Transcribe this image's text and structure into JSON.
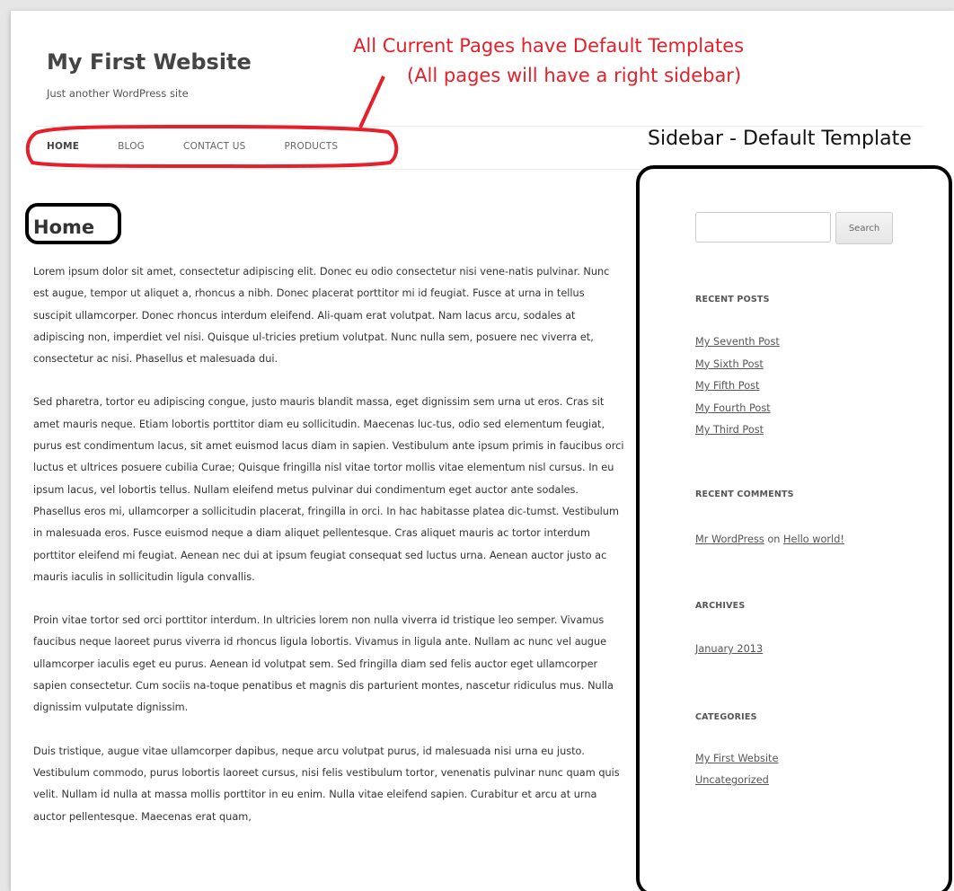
{
  "site": {
    "title": "My First Website",
    "description": "Just another WordPress site"
  },
  "nav": {
    "items": [
      "HOME",
      "BLOG",
      "CONTACT US",
      "PRODUCTS"
    ]
  },
  "annotations": {
    "red_line1": "All Current Pages have Default Templates",
    "red_line2": "(All pages will have a right sidebar)",
    "sidebar_label": "Sidebar - Default Template",
    "red_color": "#e5202b",
    "black_color": "#000000"
  },
  "page": {
    "title": "Home",
    "paragraphs": [
      "Lorem ipsum dolor sit amet, consectetur adipiscing elit. Donec eu odio consectetur nisi vene-natis pulvinar. Nunc est augue, tempor ut aliquet a, rhoncus a nibh. Donec placerat porttitor mi id feugiat. Fusce at urna in tellus suscipit ullamcorper. Donec rhoncus interdum eleifend. Ali-quam erat volutpat. Nam lacus arcu, sodales at adipiscing non, imperdiet vel nisi. Quisque ul-tricies pretium volutpat. Nunc nulla sem, posuere nec viverra et, consectetur ac nisi. Phasellus et malesuada dui.",
      "Sed pharetra, tortor eu adipiscing congue, justo mauris blandit massa, eget dignissim sem urna ut eros. Cras sit amet mauris neque. Etiam lobortis porttitor diam eu sollicitudin. Maecenas luc-tus, odio sed elementum feugiat, purus est condimentum lacus, sit amet euismod lacus diam in sapien. Vestibulum ante ipsum primis in faucibus orci luctus et ultrices posuere cubilia Curae; Quisque fringilla nisl vitae tortor mollis vitae elementum nisl cursus. In eu ipsum lacus, vel lobortis tellus. Nullam eleifend metus pulvinar dui condimentum eget auctor ante sodales. Phasellus eros mi, ullamcorper a sollicitudin placerat, fringilla in orci. In hac habitasse platea dic-tumst. Vestibulum in malesuada eros. Fusce euismod neque a diam aliquet pellentesque. Cras aliquet mauris ac tortor interdum porttitor eleifend mi feugiat. Aenean nec dui at ipsum feugiat consequat sed luctus urna. Aenean auctor justo ac mauris iaculis in sollicitudin ligula convallis.",
      "Proin vitae tortor sed orci porttitor interdum. In ultricies lorem non nulla viverra id tristique leo semper. Vivamus faucibus neque laoreet purus viverra id rhoncus ligula lobortis. Vivamus in ligula ante. Nullam ac nunc vel augue ullamcorper iaculis eget eu purus. Aenean id volutpat sem. Sed fringilla diam sed felis auctor eget ullamcorper sapien consectetur. Cum sociis na-toque penatibus et magnis dis parturient montes, nascetur ridiculus mus. Nulla dignissim vulputate dignissim.",
      "Duis tristique, augue vitae ullamcorper dapibus, neque arcu volutpat purus, id malesuada nisi urna eu justo. Vestibulum commodo, purus lobortis laoreet cursus, nisi felis vestibulum tortor, venenatis pulvinar nunc quam quis velit. Nullam id nulla at massa mollis porttitor in eu enim. Nulla vitae eleifend sapien. Curabitur et arcu at urna auctor pellentesque. Maecenas erat quam,"
    ]
  },
  "sidebar": {
    "search_button": "Search",
    "search_placeholder": "",
    "recent_posts": {
      "title": "RECENT POSTS",
      "items": [
        "My Seventh Post",
        "My Sixth Post",
        "My Fifth Post",
        "My Fourth Post",
        "My Third Post"
      ]
    },
    "recent_comments": {
      "title": "RECENT COMMENTS",
      "author": "Mr WordPress",
      "connector": "on",
      "post": "Hello world!"
    },
    "archives": {
      "title": "ARCHIVES",
      "items": [
        "January 2013"
      ]
    },
    "categories": {
      "title": "CATEGORIES",
      "items": [
        "My First Website",
        "Uncategorized"
      ]
    }
  }
}
